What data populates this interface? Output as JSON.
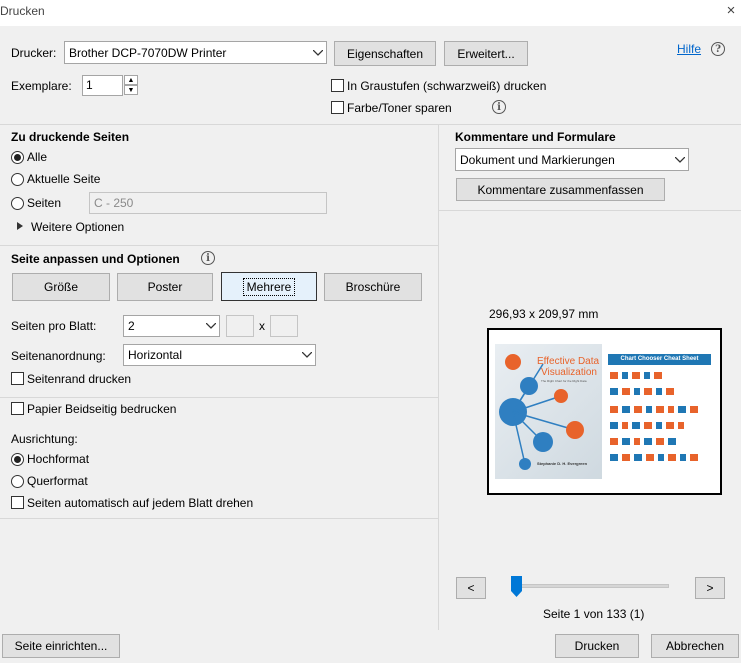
{
  "window": {
    "title": "Drucken",
    "close": "×"
  },
  "printer": {
    "label": "Drucker:",
    "selected": "Brother DCP-7070DW Printer",
    "properties_button": "Eigenschaften",
    "advanced_button": "Erweitert...",
    "help_link": "Hilfe"
  },
  "copies": {
    "label": "Exemplare:",
    "value": "1"
  },
  "options_top": {
    "grayscale": "In Graustufen (schwarzweiß) drucken",
    "save_toner": "Farbe/Toner sparen"
  },
  "pages_to_print": {
    "heading": "Zu druckende Seiten",
    "all": "Alle",
    "current": "Aktuelle Seite",
    "pages": "Seiten",
    "pages_placeholder": "C - 250",
    "more_options": "Weitere Optionen"
  },
  "sizing": {
    "heading": "Seite anpassen und Optionen",
    "tabs": [
      "Größe",
      "Poster",
      "Mehrere",
      "Broschüre"
    ],
    "active_tab": "Mehrere",
    "pages_per_sheet_label": "Seiten pro Blatt:",
    "pages_per_sheet_value": "2",
    "times": "x",
    "page_order_label": "Seitenanordnung:",
    "page_order_value": "Horizontal",
    "print_border": "Seitenrand drucken"
  },
  "duplex": {
    "label": "Papier Beidseitig bedrucken"
  },
  "orientation": {
    "heading": "Ausrichtung:",
    "portrait": "Hochformat",
    "landscape": "Querformat",
    "auto_rotate": "Seiten automatisch auf jedem Blatt drehen"
  },
  "comments": {
    "heading": "Kommentare und Formulare",
    "selected": "Dokument und Markierungen",
    "summarize_button": "Kommentare zusammenfassen"
  },
  "preview": {
    "size": "296,93 x 209,97 mm",
    "page_info": "Seite 1 von 133 (1)",
    "prev": "<",
    "next": ">",
    "slider_fraction": 0.0,
    "thumb_left": {
      "title_line1": "Effective Data",
      "title_line2": "Visualization",
      "subtitle": "The Right Chart for the Right Data",
      "author": "Stephanie D. H. Evergreen"
    },
    "thumb_right": {
      "title": "Chart Chooser Cheat Sheet"
    }
  },
  "footer": {
    "page_setup": "Seite einrichten...",
    "print": "Drucken",
    "cancel": "Abbrechen"
  },
  "colors": {
    "accent": "#0078d7",
    "link": "#0066cc",
    "thumb_orange": "#e8632b",
    "thumb_blue": "#1f77b4"
  }
}
